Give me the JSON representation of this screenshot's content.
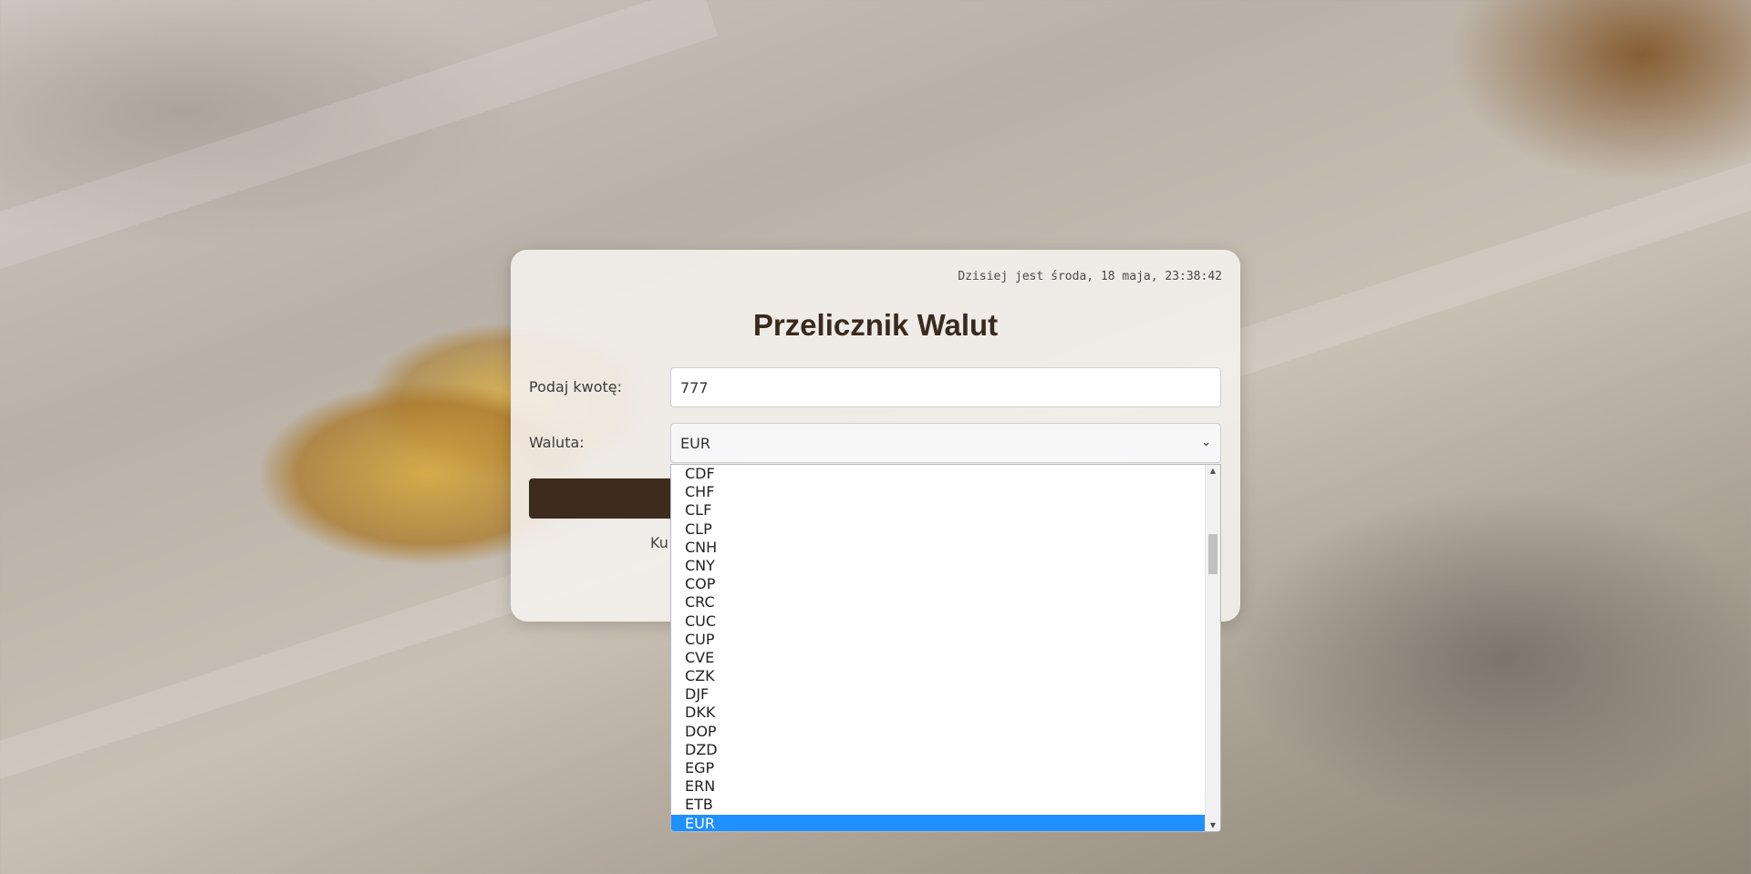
{
  "app": {
    "clock_text": "Dzisiej jest środa, 18 maja, 23:38:42",
    "title": "Przelicznik Walut"
  },
  "form": {
    "amount_label": "Podaj kwotę:",
    "amount_value": "777",
    "currency_label": "Waluta:",
    "currency_selected": "EUR",
    "convert_button_label": "",
    "rate_text_partial": "Ku"
  },
  "dropdown": {
    "options": [
      "CDF",
      "CHF",
      "CLF",
      "CLP",
      "CNH",
      "CNY",
      "COP",
      "CRC",
      "CUC",
      "CUP",
      "CVE",
      "CZK",
      "DJF",
      "DKK",
      "DOP",
      "DZD",
      "EGP",
      "ERN",
      "ETB",
      "EUR"
    ],
    "selected_index": 19
  },
  "colors": {
    "accent_selected": "#1e90ff",
    "button_dark": "#3d2b1d",
    "title_color": "#3a2a1d"
  }
}
